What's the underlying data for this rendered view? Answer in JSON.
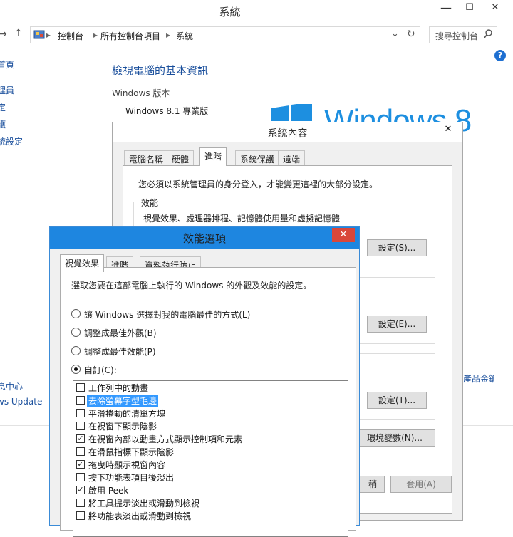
{
  "main_window": {
    "title": "系統",
    "minimize_glyph": "—",
    "maximize_glyph": "☐",
    "close_glyph": "✕",
    "address": {
      "segments": [
        "控制台",
        "所有控制台項目",
        "系統"
      ],
      "separator": "▸",
      "dropdown_glyph": "⌄",
      "refresh_glyph": "↻"
    },
    "search_placeholder": "搜尋控制台",
    "help_glyph": "?",
    "left_nav": [
      "首頁",
      "理員",
      "定",
      "護",
      "統設定"
    ],
    "left_nav_bottom": [
      "息中心",
      "ws Update"
    ],
    "heading": "檢視電腦的基本資訊",
    "edition_label": "Windows 版本",
    "edition_value": "Windows 8.1 專業版",
    "logo_word": "Windows 8",
    "side_link_fragment": "產品金鑰",
    "accent_color": "#1d8fe0"
  },
  "system_properties": {
    "title": "系統內容",
    "close_glyph": "✕",
    "tabs": [
      "電腦名稱",
      "硬體",
      "進階",
      "系統保護",
      "遠端"
    ],
    "active_tab": "進階",
    "admin_notice": "您必須以系統管理員的身分登入，才能變更這裡的大部分設定。",
    "perf_group_label": "效能",
    "perf_group_desc": "視覺效果、處理器排程、記憶體使用量和虛擬記憶體",
    "buttons": {
      "perf_settings": "設定(S)...",
      "profile_settings": "設定(E)...",
      "startup_settings": "設定(T)...",
      "env_vars_fragment": "環境變數(N)...",
      "ok_fragment": "稍",
      "apply": "套用(A)"
    }
  },
  "performance_options": {
    "title": "效能選項",
    "close_glyph": "✕",
    "tabs": [
      "視覺效果",
      "進階",
      "資料執行防止"
    ],
    "active_tab": "視覺效果",
    "description": "選取您要在這部電腦上執行的 Windows 的外觀及效能的設定。",
    "radios": [
      {
        "label": "讓 Windows 選擇對我的電腦最佳的方式(L)",
        "checked": false
      },
      {
        "label": "調整成最佳外觀(B)",
        "checked": false
      },
      {
        "label": "調整成最佳效能(P)",
        "checked": false
      },
      {
        "label": "自訂(C):",
        "checked": true
      }
    ],
    "checkmark_glyph": "✓",
    "options": [
      {
        "label": "工作列中的動畫",
        "checked": false,
        "selected": false
      },
      {
        "label": "去除螢幕字型毛邊",
        "checked": false,
        "selected": true
      },
      {
        "label": "平滑捲動的清單方塊",
        "checked": false,
        "selected": false
      },
      {
        "label": "在視窗下顯示陰影",
        "checked": false,
        "selected": false
      },
      {
        "label": "在視窗內部以動畫方式顯示控制項和元素",
        "checked": true,
        "selected": false
      },
      {
        "label": "在滑鼠指標下顯示陰影",
        "checked": false,
        "selected": false
      },
      {
        "label": "拖曳時顯示視窗內容",
        "checked": true,
        "selected": false
      },
      {
        "label": "按下功能表項目後淡出",
        "checked": false,
        "selected": false
      },
      {
        "label": "啟用 Peek",
        "checked": true,
        "selected": false
      },
      {
        "label": "將工具提示淡出或滑動到檢視",
        "checked": false,
        "selected": false
      },
      {
        "label": "將功能表淡出或滑動到檢視",
        "checked": false,
        "selected": false
      }
    ]
  }
}
